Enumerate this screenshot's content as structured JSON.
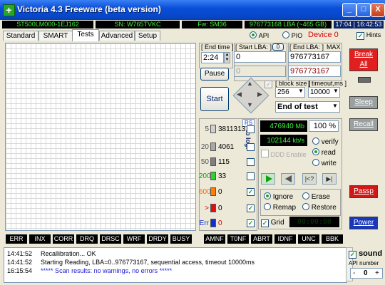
{
  "window": {
    "title": "Victoria 4.3 Freeware (beta version)",
    "icon_glyph": "+"
  },
  "title_buttons": {
    "minimize": "_",
    "maximize": "□",
    "close": "X"
  },
  "infobar": {
    "model": "ST500LM000-1EJ162",
    "serial": "SN: W765TVKC",
    "firmware": "Fw: SM36",
    "capacity": "976773168 LBA (~465 GB)",
    "time": "17:04 | 16:42:53"
  },
  "tabs": [
    {
      "label": "Standard"
    },
    {
      "label": "SMART"
    },
    {
      "label": "Tests"
    },
    {
      "label": "Advanced"
    },
    {
      "label": "Setup"
    }
  ],
  "mode": {
    "api": "API",
    "pio": "PIO",
    "device": "Device 0",
    "hints": "Hints"
  },
  "end_time": {
    "label": "[ End time ]",
    "value": "2:24"
  },
  "start_lba": {
    "label": "[ Start LBA: ]",
    "zero": "0",
    "value": "0",
    "secondary": "0"
  },
  "end_lba": {
    "label": "[ End LBA: ]",
    "max": "MAX",
    "value": "976773167",
    "secondary": "976773167"
  },
  "buttons": {
    "pause": "Pause",
    "start": "Start"
  },
  "block_size": {
    "label": "[ block size ]",
    "value": "256"
  },
  "timeout": {
    "label": "[ timeout,ms ]",
    "value": "10000"
  },
  "end_action": "End of test",
  "counters": {
    "rs": "RS",
    "to_log": "to log:",
    "rows": [
      {
        "label": "5",
        "count": "3811313",
        "color": "#d0d0d0"
      },
      {
        "label": "20",
        "count": "4061",
        "color": "#a8a8a8"
      },
      {
        "label": "50",
        "count": "115",
        "color": "#808080"
      },
      {
        "label": "200",
        "count": "33",
        "color": "#2fd12f"
      },
      {
        "label": "600",
        "count": "0",
        "color": "#ff8000"
      },
      {
        "label": ">",
        "count": "0",
        "color": "#e01010"
      },
      {
        "label": "Err",
        "count": "0",
        "color": "#1030d0"
      }
    ]
  },
  "progress": {
    "mb": "476940",
    "mb_unit": "Mb",
    "percent": "100",
    "percent_unit": "%",
    "speed": "102144",
    "speed_unit": "kb/s",
    "ddd": "DDD Enable"
  },
  "rw_mode": {
    "verify": "verify",
    "read": "read",
    "write": "write"
  },
  "actions": {
    "ignore": "Ignore",
    "erase": "Erase",
    "remap": "Remap",
    "restore": "Restore",
    "grid": "Grid",
    "timer": "00:00:00"
  },
  "right_panel": {
    "break": "Break All",
    "sleep": "Sleep",
    "recall": "Recall",
    "passp": "Passp",
    "power": "Power",
    "sound": "sound",
    "api_number_label": "API number",
    "api_number": "0"
  },
  "status_flags_left": [
    "ERR",
    "INX",
    "CORR",
    "DRQ",
    "DRSC",
    "WRF",
    "DRDY",
    "BUSY"
  ],
  "status_flags_right": [
    "AMNF",
    "T0NF",
    "ABRT",
    "IDNF",
    "UNC",
    "BBK"
  ],
  "log": [
    {
      "time": "14:41:52",
      "text": "Recallibration... OK",
      "color": "#000000"
    },
    {
      "time": "14:41:52",
      "text": "Starting Reading, LBA=0..976773167, sequential access, timeout 10000ms",
      "color": "#000000"
    },
    {
      "time": "16:15:54",
      "text": "***** Scan results: no warnings, no errors *****",
      "color": "#1a1ad0"
    }
  ]
}
